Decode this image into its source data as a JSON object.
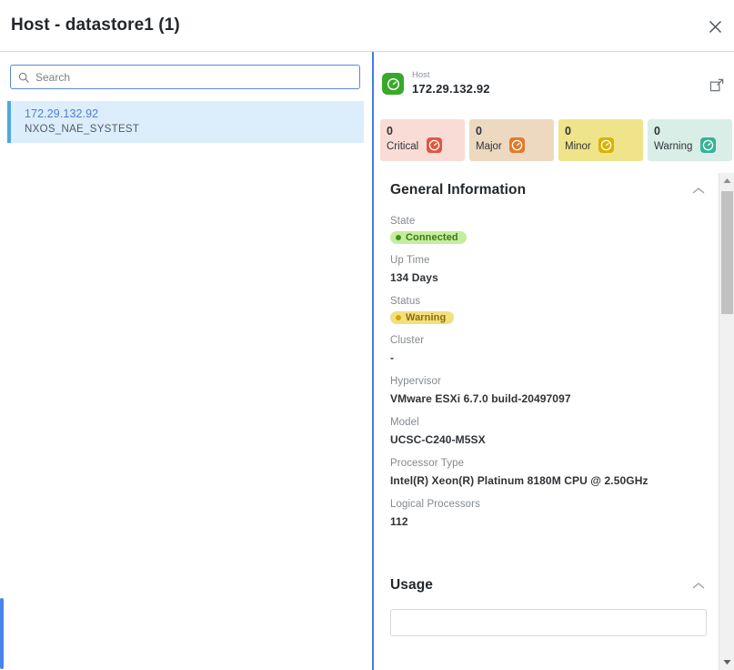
{
  "window": {
    "title": "Host - datastore1 (1)",
    "close_icon": "close-icon"
  },
  "left_panel": {
    "search": {
      "placeholder": "Search",
      "value": "",
      "icon": "search-icon"
    },
    "results": [
      {
        "title": "172.29.132.92",
        "subtitle": "NXOS_NAE_SYSTEST",
        "selected": true
      }
    ]
  },
  "right_panel": {
    "entity": {
      "type_label": "Host",
      "name": "172.29.132.92",
      "icon": "host-gauge-icon",
      "icon_color": "#3aa82a",
      "expand_icon": "open-in-new-window-icon"
    },
    "severity": [
      {
        "count": "0",
        "label": "Critical",
        "bg": "#f9dcd6",
        "chip": "#dd5740",
        "icon": "critical-alert-icon"
      },
      {
        "count": "0",
        "label": "Major",
        "bg": "#ecd9c0",
        "chip": "#e07b2a",
        "icon": "major-alert-icon"
      },
      {
        "count": "0",
        "label": "Minor",
        "bg": "#f0e48a",
        "chip": "#d9b300",
        "icon": "minor-alert-icon"
      },
      {
        "count": "0",
        "label": "Warning",
        "bg": "#d8eee7",
        "chip": "#37b295",
        "icon": "warning-alert-icon"
      }
    ],
    "sections": [
      {
        "title": "General Information",
        "collapse_icon": "chevron-up-icon"
      },
      {
        "title": "Usage",
        "collapse_icon": "chevron-up-icon"
      }
    ],
    "general_information": {
      "state": {
        "label": "State",
        "value": "Connected",
        "style": "pill-connected"
      },
      "up_time": {
        "label": "Up Time",
        "value": "134 Days"
      },
      "status": {
        "label": "Status",
        "value": "Warning",
        "style": "pill-warning"
      },
      "cluster": {
        "label": "Cluster",
        "value": "-"
      },
      "hypervisor": {
        "label": "Hypervisor",
        "value": "VMware ESXi 6.7.0 build-20497097"
      },
      "model": {
        "label": "Model",
        "value": "UCSC-C240-M5SX"
      },
      "processor_type": {
        "label": "Processor Type",
        "value": "Intel(R) Xeon(R) Platinum 8180M CPU @ 2.50GHz"
      },
      "logical_processors": {
        "label": "Logical Processors",
        "value": "112"
      }
    },
    "scrollbar": {
      "up_icon": "scroll-up-arrow-icon",
      "down_icon": "scroll-down-arrow-icon"
    }
  }
}
